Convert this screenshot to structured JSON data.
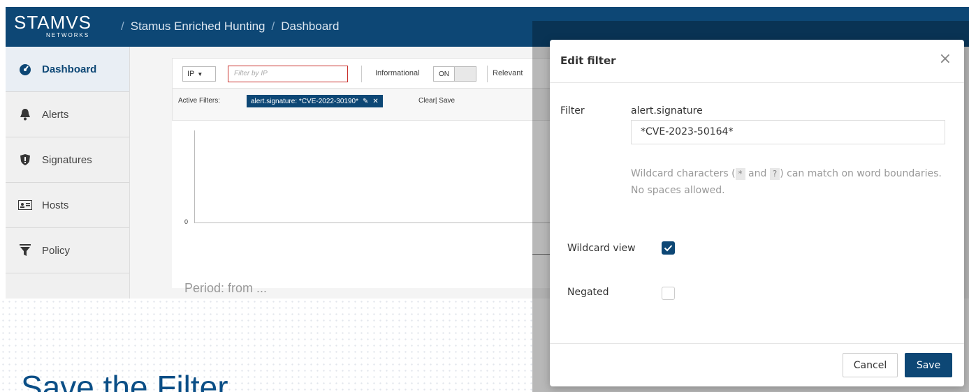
{
  "slide": {
    "title": "Save the Filter"
  },
  "app": {
    "logo_main": "STAMVS",
    "logo_sub": "NETWORKS",
    "breadcrumb": [
      "Stamus Enriched Hunting",
      "Dashboard"
    ],
    "breadcrumb_sep": "/",
    "sidebar": {
      "items": [
        {
          "label": "Dashboard",
          "icon": "dashboard-icon"
        },
        {
          "label": "Alerts",
          "icon": "bell-icon"
        },
        {
          "label": "Signatures",
          "icon": "shield-icon"
        },
        {
          "label": "Hosts",
          "icon": "id-card-icon"
        },
        {
          "label": "Policy",
          "icon": "filter-icon"
        }
      ]
    },
    "toolbar": {
      "ip_select": "IP",
      "filter_placeholder": "Filter by IP",
      "informational_label": "Informational",
      "informational_toggle": "ON",
      "relevant_label": "Relevant"
    },
    "active_filters": {
      "label": "Active Filters:",
      "chip": "alert.signature: *CVE-2022-30190*",
      "clear": "Clear",
      "save": "Save"
    },
    "chart": {
      "zero_label": "0",
      "period_label": "Period: from ..."
    }
  },
  "modal": {
    "title": "Edit filter",
    "close": "×",
    "filter_label": "Filter",
    "field_name": "alert.signature",
    "field_value": "*CVE-2023-50164*",
    "help_prefix": "Wildcard characters (",
    "help_star": "*",
    "help_and": "and",
    "help_q": "?",
    "help_suffix": ") can match on word boundaries.",
    "help_line2": "No spaces allowed.",
    "wildcard_label": "Wildcard view",
    "wildcard_checked": true,
    "negated_label": "Negated",
    "negated_checked": false,
    "cancel": "Cancel",
    "save": "Save"
  }
}
